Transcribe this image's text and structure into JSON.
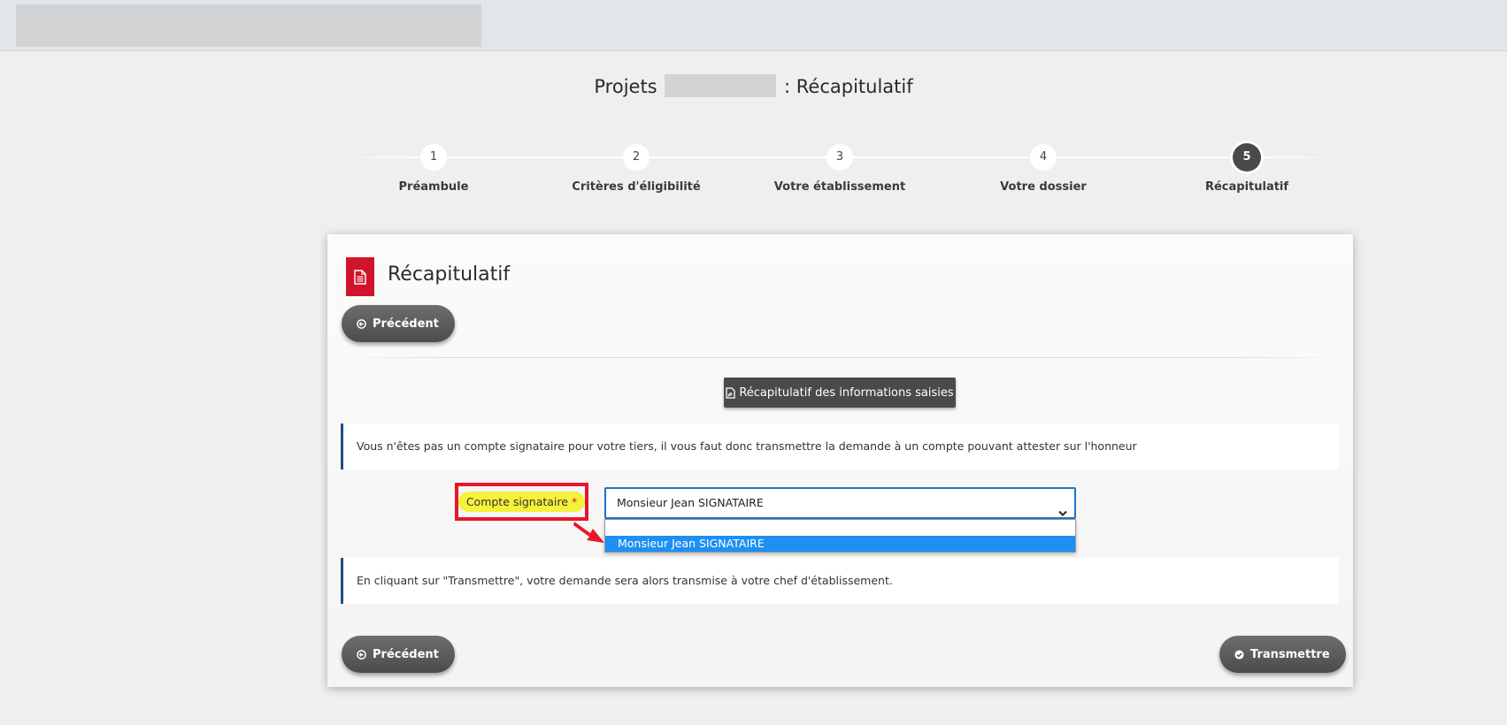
{
  "header": {
    "title_prefix": "Projets",
    "title_suffix": ": Récapitulatif"
  },
  "steps": [
    {
      "number": "1",
      "label": "Préambule"
    },
    {
      "number": "2",
      "label": "Critères d'éligibilité"
    },
    {
      "number": "3",
      "label": "Votre établissement"
    },
    {
      "number": "4",
      "label": "Votre dossier"
    },
    {
      "number": "5",
      "label": "Récapitulatif"
    }
  ],
  "active_step": "5",
  "card": {
    "title": "Récapitulatif",
    "prev_label": "Précédent",
    "recap_button_label": "Récapitulatif des informations saisies",
    "info_signatory": "Vous n'êtes pas un compte signataire pour votre tiers, il vous faut donc transmettre la demande à un compte pouvant attester sur l'honneur",
    "field_label": "Compte signataire",
    "required_mark": "*",
    "select_value": "Monsieur Jean SIGNATAIRE",
    "dropdown_options": [
      "",
      "Monsieur Jean SIGNATAIRE"
    ],
    "info_transmit": "En cliquant sur \"Transmettre\", votre demande sera alors transmise à votre chef d'établissement.",
    "submit_label": "Transmettre"
  },
  "colors": {
    "accent_red": "#d0142b",
    "focus_blue": "#1e74c6",
    "selected_option": "#1e8ff3",
    "highlight_yellow": "#f6f13a",
    "info_border": "#1f4f86"
  },
  "icons": {
    "doc": "file-text-icon",
    "prev": "arrow-circle-left-icon",
    "pdf": "file-pdf-icon",
    "submit": "check-circle-icon",
    "select": "chevron-down-icon",
    "annotation": "red-arrow-icon"
  }
}
